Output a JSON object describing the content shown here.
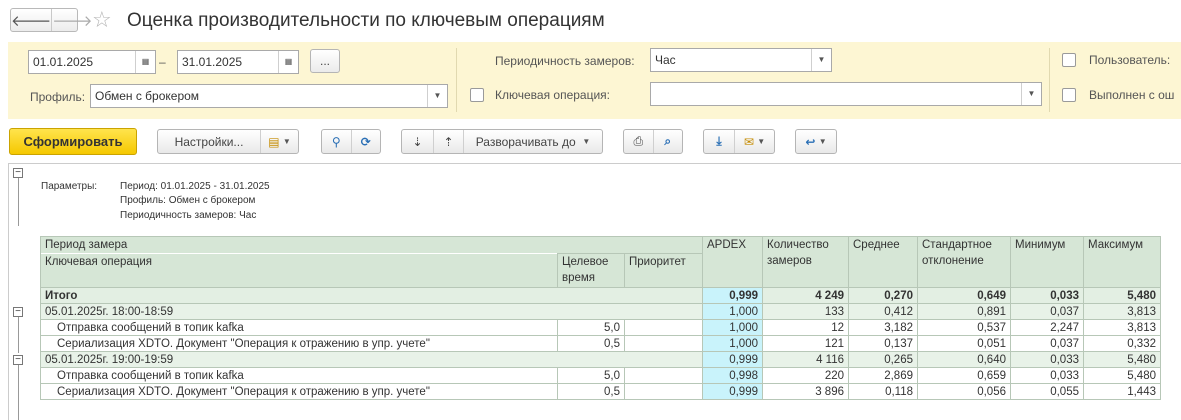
{
  "window": {
    "title": "Оценка производительности по ключевым операциям"
  },
  "filters": {
    "date_from": "01.01.2025",
    "date_sep": "–",
    "date_to": "31.01.2025",
    "more_label": "...",
    "profile_label": "Профиль:",
    "profile_value": "Обмен с брокером",
    "periodicity_label": "Периодичность замеров:",
    "periodicity_value": "Час",
    "key_op_label": "Ключевая операция:",
    "key_op_value": "",
    "user_label": "Пользователь:",
    "errors_label": "Выполнен с ош"
  },
  "toolbar": {
    "generate_label": "Сформировать",
    "settings_label": "Настройки...",
    "expand_label": "Разворачивать до"
  },
  "report": {
    "params_label": "Параметры:",
    "params": [
      "Период: 01.01.2025 - 31.01.2025",
      "Профиль: Обмен с брокером",
      "Периодичность замеров: Час"
    ],
    "headers": {
      "period": "Период замера",
      "key_op": "Ключевая операция",
      "target_time": "Целевое время",
      "priority": "Приоритет",
      "apdex": "APDEX",
      "count": "Количество замеров",
      "avg": "Среднее",
      "stddev": "Стандартное отклонение",
      "min": "Минимум",
      "max": "Максимум"
    },
    "rows": [
      {
        "label": "Итого",
        "target": "",
        "priority": "",
        "apdex": "0,999",
        "count": "4 249",
        "avg": "0,270",
        "stddev": "0,649",
        "min": "0,033",
        "max": "5,480"
      },
      {
        "label": "05.01.2025г.  18:00-18:59",
        "target": "",
        "priority": "",
        "apdex": "1,000",
        "count": "133",
        "avg": "0,412",
        "stddev": "0,891",
        "min": "0,037",
        "max": "3,813"
      },
      {
        "label": "Отправка сообщений в топик kafka",
        "target": "5,0",
        "priority": "",
        "apdex": "1,000",
        "count": "12",
        "avg": "3,182",
        "stddev": "0,537",
        "min": "2,247",
        "max": "3,813"
      },
      {
        "label": "Сериализация XDTO. Документ \"Операция к отражению в упр. учете\"",
        "target": "0,5",
        "priority": "",
        "apdex": "1,000",
        "count": "121",
        "avg": "0,137",
        "stddev": "0,051",
        "min": "0,037",
        "max": "0,332"
      },
      {
        "label": "05.01.2025г.  19:00-19:59",
        "target": "",
        "priority": "",
        "apdex": "0,999",
        "count": "4 116",
        "avg": "0,265",
        "stddev": "0,640",
        "min": "0,033",
        "max": "5,480"
      },
      {
        "label": "Отправка сообщений в топик kafka",
        "target": "5,0",
        "priority": "",
        "apdex": "0,998",
        "count": "220",
        "avg": "2,869",
        "stddev": "0,659",
        "min": "0,033",
        "max": "5,480"
      },
      {
        "label": "Сериализация XDTO. Документ \"Операция к отражению в упр. учете\"",
        "target": "0,5",
        "priority": "",
        "apdex": "0,999",
        "count": "3 896",
        "avg": "0,118",
        "stddev": "0,056",
        "min": "0,055",
        "max": "1,443"
      }
    ]
  },
  "colors": {
    "filter_bg": "#fdf6d3",
    "primary_btn": "#f5c800",
    "header_bg": "#d6e6d6",
    "apdex_bg": "#c9f3fb"
  }
}
